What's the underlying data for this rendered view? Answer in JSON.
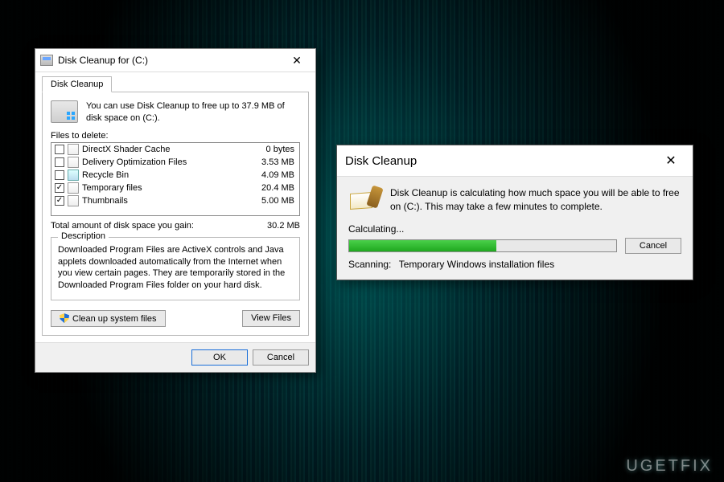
{
  "watermark": "UGETFIX",
  "dlg1": {
    "title": "Disk Cleanup for  (C:)",
    "tab": "Disk Cleanup",
    "intro": "You can use Disk Cleanup to free up to 37.9 MB of disk space on  (C:).",
    "files_label": "Files to delete:",
    "items": [
      {
        "name": "DirectX Shader Cache",
        "size": "0 bytes",
        "checked": false,
        "icon": "file"
      },
      {
        "name": "Delivery Optimization Files",
        "size": "3.53 MB",
        "checked": false,
        "icon": "file"
      },
      {
        "name": "Recycle Bin",
        "size": "4.09 MB",
        "checked": false,
        "icon": "recycle"
      },
      {
        "name": "Temporary files",
        "size": "20.4 MB",
        "checked": true,
        "icon": "file"
      },
      {
        "name": "Thumbnails",
        "size": "5.00 MB",
        "checked": true,
        "icon": "file"
      }
    ],
    "total_label": "Total amount of disk space you gain:",
    "total_value": "30.2 MB",
    "desc_legend": "Description",
    "desc_text": "Downloaded Program Files are ActiveX controls and Java applets downloaded automatically from the Internet when you view certain pages. They are temporarily stored in the Downloaded Program Files folder on your hard disk.",
    "btn_cleanup": "Clean up system files",
    "btn_viewfiles": "View Files",
    "btn_ok": "OK",
    "btn_cancel": "Cancel"
  },
  "dlg2": {
    "title": "Disk Cleanup",
    "intro": "Disk Cleanup is calculating how much space you will be able to free on  (C:). This may take a few minutes to complete.",
    "calc_label": "Calculating...",
    "progress_pct": 55,
    "btn_cancel": "Cancel",
    "scan_label": "Scanning:",
    "scan_value": "Temporary Windows installation files"
  }
}
